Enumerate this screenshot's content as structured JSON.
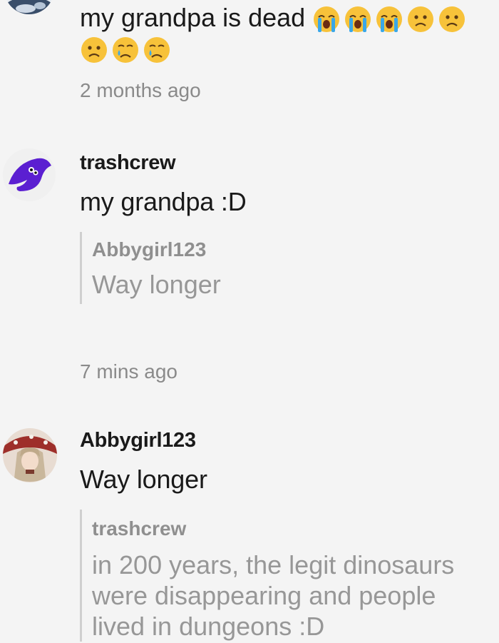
{
  "comments": [
    {
      "text": "my grandpa is dead",
      "emojis": [
        "loudly-crying-face",
        "loudly-crying-face",
        "loudly-crying-face",
        "worried-face",
        "worried-face",
        "worried-face",
        "crying-face",
        "crying-face"
      ],
      "time": "2 months ago"
    },
    {
      "username": "trashcrew",
      "text": "my grandpa :D",
      "quote": {
        "username": "Abbygirl123",
        "text": "Way longer"
      },
      "time": "7 mins ago"
    },
    {
      "username": "Abbygirl123",
      "text": "Way longer",
      "quote": {
        "username": "trashcrew",
        "lines": [
          "in 200 years, the legit dinosaurs",
          "were disappearing and people",
          "lived in dungeons :D"
        ]
      }
    }
  ],
  "colors": {
    "background": "#f4f4f4",
    "text": "#1a1a1a",
    "muted": "#8a8a8a",
    "quote_bar": "#cfcfcf",
    "emoji_yellow": "#f7c23a",
    "tear_blue": "#3aa7e8"
  }
}
